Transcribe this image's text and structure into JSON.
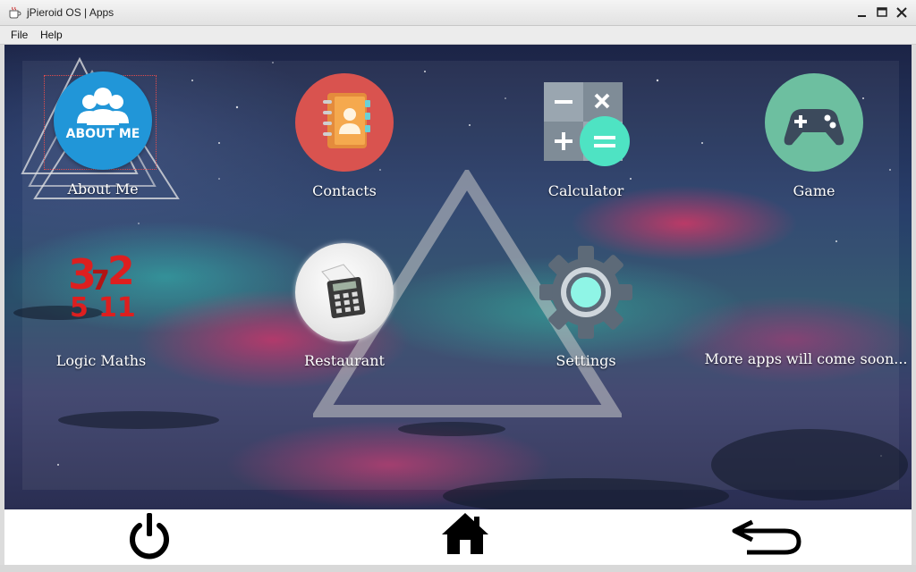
{
  "window": {
    "title": "jPieroid OS | Apps",
    "app_icon": "coffee-cup-icon",
    "controls": [
      "minimize-icon",
      "maximize-icon",
      "close-icon"
    ]
  },
  "menu": {
    "file": "File",
    "help": "Help"
  },
  "apps": [
    {
      "label": "About Me",
      "icon": "about-me-icon",
      "icon_text": "ABOUT ME"
    },
    {
      "label": "Contacts",
      "icon": "address-book-icon"
    },
    {
      "label": "Calculator",
      "icon": "calculator-icon"
    },
    {
      "label": "Game",
      "icon": "gamepad-icon"
    },
    {
      "label": "Logic Maths",
      "icon": "logic-maths-icon",
      "icon_numbers": [
        "3",
        "2",
        "7",
        "5",
        "11"
      ]
    },
    {
      "label": "Restaurant",
      "icon": "restaurant-bill-icon"
    },
    {
      "label": "Settings",
      "icon": "gear-icon"
    }
  ],
  "more_text": "More apps will come soon...",
  "navbar": {
    "power": "power-icon",
    "home": "home-icon",
    "back": "back-arrow-icon"
  },
  "colors": {
    "about_blue": "#2196d8",
    "contacts_red": "#d9534f",
    "game_green": "#6dbfa0",
    "calc_teal": "#4ee3c3",
    "logic_red": "#dd1f1f"
  }
}
